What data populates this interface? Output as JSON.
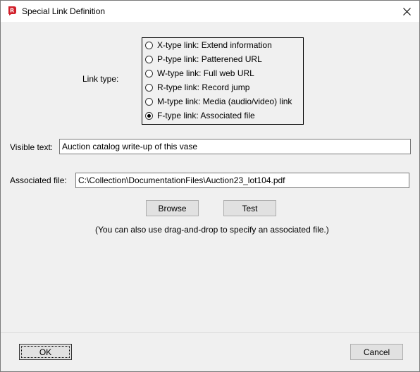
{
  "window": {
    "title": "Special Link Definition"
  },
  "link_type": {
    "label": "Link type:",
    "options": [
      {
        "label": "X-type link: Extend information",
        "checked": false
      },
      {
        "label": "P-type link: Patterened URL",
        "checked": false
      },
      {
        "label": "W-type link: Full web URL",
        "checked": false
      },
      {
        "label": "R-type link: Record jump",
        "checked": false
      },
      {
        "label": "M-type link: Media (audio/video) link",
        "checked": false
      },
      {
        "label": "F-type link: Associated file",
        "checked": true
      }
    ]
  },
  "visible_text": {
    "label": "Visible text:",
    "value": "Auction catalog write-up of this vase"
  },
  "associated_file": {
    "label": "Associated file:",
    "value": "C:\\Collection\\DocumentationFiles\\Auction23_lot104.pdf"
  },
  "buttons": {
    "browse": "Browse",
    "test": "Test",
    "ok": "OK",
    "cancel": "Cancel"
  },
  "hint": "(You can also use drag-and-drop to specify an associated file.)"
}
